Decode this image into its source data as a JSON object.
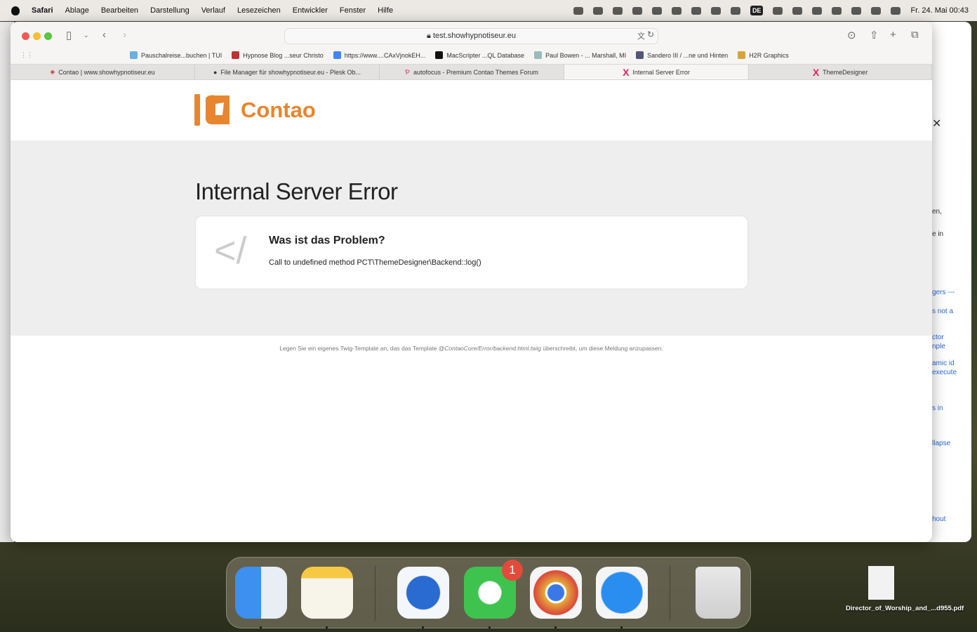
{
  "menubar": {
    "app": "Safari",
    "items": [
      "Ablage",
      "Bearbeiten",
      "Darstellung",
      "Verlauf",
      "Lesezeichen",
      "Entwickler",
      "Fenster",
      "Hilfe"
    ],
    "input_source": "DE",
    "clock": "Fr. 24. Mai  00:43"
  },
  "browser": {
    "url": "test.showhypnotiseur.eu",
    "bookmarks": [
      "Pauschalreise...buchen | TUI",
      "Hypnose Blog ...seur Christo",
      "https://www....CAxVjnokEH...",
      "MacScripter ...QL Database",
      "Paul Bowen - ... Marshall, MI",
      "Sandero III / ...ne und Hinten",
      "H2R Graphics"
    ],
    "tabs": [
      {
        "label": "Contao | www.showhypnotiseur.eu",
        "active": false
      },
      {
        "label": "File Manager für showhypnotiseur.eu - Plesk Ob...",
        "active": false
      },
      {
        "label": "autofocus - Premium Contao Themes Forum",
        "active": false
      },
      {
        "label": "Internal Server Error",
        "active": true
      },
      {
        "label": "ThemeDesigner",
        "active": false
      }
    ]
  },
  "page": {
    "logo": "Contao",
    "title": "Internal Server Error",
    "card_symbol": "</",
    "problem_heading": "Was ist das Problem?",
    "problem_text": "Call to undefined method PCT\\ThemeDesigner\\Backend::log()",
    "footer_pre": "Legen Sie ein eigenes Twig-Template an, das das Template ",
    "footer_template": "@ContaoCore/Error/backend.html.twig",
    "footer_post": " überschreibt, um diese Meldung anzupassen."
  },
  "background_window": {
    "fragments": [
      "en,",
      "e in",
      "gers ---",
      "s not a",
      "ctor",
      "nple",
      "amic id",
      "execute",
      "s in",
      "llapse",
      "hout"
    ]
  },
  "dock": {
    "apps": [
      "Finder",
      "Notizen",
      "Thunderbird",
      "WhatsApp",
      "Google Chrome",
      "Safari",
      "Papierkorb"
    ],
    "whatsapp_badge": "1"
  },
  "desktop": {
    "file": "Director_of_Worship_and_...d955.pdf"
  },
  "colors": {
    "brand": "#e8852f",
    "tab_icon": "#e0245e"
  }
}
